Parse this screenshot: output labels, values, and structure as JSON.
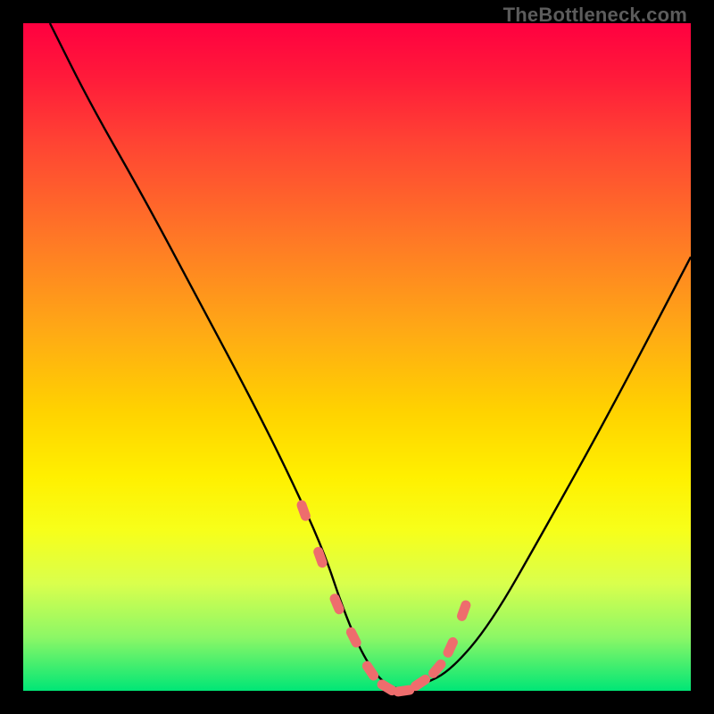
{
  "watermark": "TheBottleneck.com",
  "chart_data": {
    "type": "line",
    "title": "",
    "xlabel": "",
    "ylabel": "",
    "xlim": [
      0,
      100
    ],
    "ylim": [
      0,
      100
    ],
    "series": [
      {
        "name": "curve",
        "x": [
          4,
          10,
          18,
          26,
          34,
          40,
          45,
          48,
          51,
          54,
          57,
          60,
          64,
          70,
          78,
          88,
          100
        ],
        "y": [
          100,
          88,
          74,
          59,
          44,
          32,
          21,
          12,
          5,
          1,
          0,
          1,
          3,
          10,
          24,
          42,
          65
        ]
      }
    ],
    "markers": {
      "name": "highlight-region",
      "color": "#ee6d6d",
      "x": [
        42,
        44.5,
        47,
        49.5,
        52,
        54.5,
        57,
        59.5,
        62,
        64,
        66
      ],
      "y": [
        27,
        20,
        13,
        8,
        3,
        0.5,
        0,
        1.2,
        3.3,
        6.5,
        12
      ]
    }
  },
  "colors": {
    "curve": "#000000",
    "marker": "#ee6d6d",
    "background_top": "#ff0040",
    "background_bottom": "#00e676"
  }
}
